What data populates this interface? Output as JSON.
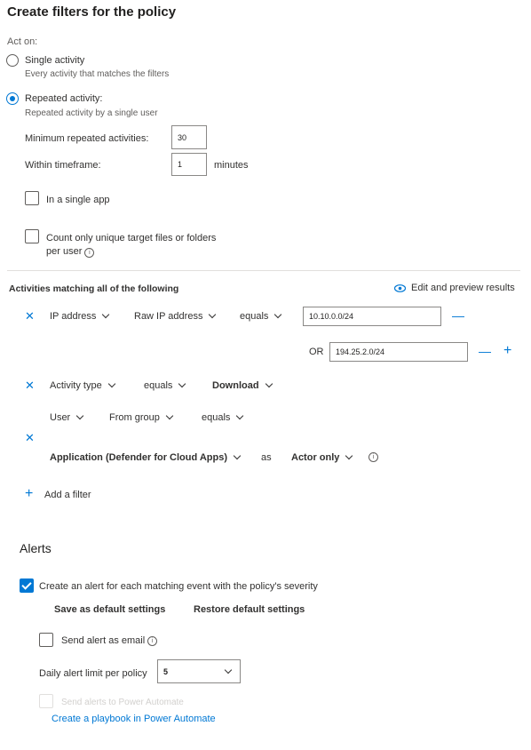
{
  "page_title": "Create filters for the policy",
  "act_on": {
    "label": "Act on:",
    "single": {
      "label": "Single activity",
      "description": "Every activity that matches the filters",
      "selected": false
    },
    "repeated": {
      "label": "Repeated activity:",
      "description": "Repeated activity by a single user",
      "selected": true
    },
    "min_label": "Minimum repeated activities:",
    "min_value": "30",
    "timeframe_label": "Within timeframe:",
    "timeframe_value": "1",
    "timeframe_unit": "minutes",
    "single_app": "In a single app",
    "unique_line1": "Count only unique target files or folders",
    "unique_line2": "per user"
  },
  "activities": {
    "header": "Activities matching all of the following",
    "edit_preview": "Edit and preview results",
    "filter1": {
      "field": "IP address",
      "subfield": "Raw IP address",
      "operator": "equals",
      "value": "10.10.0.0/24",
      "or_label": "OR",
      "value2": "194.25.2.0/24"
    },
    "filter2": {
      "field": "Activity type",
      "operator": "equals",
      "value": "Download"
    },
    "filter3": {
      "field": "User",
      "subfield": "From group",
      "operator": "equals",
      "app_field": "Application (Defender for Cloud Apps)",
      "as_label": "as",
      "actor": "Actor only"
    },
    "add_filter": "Add a filter"
  },
  "alerts": {
    "title": "Alerts",
    "create_alert": "Create an alert for each matching event with the policy's severity",
    "save_default": "Save as default settings",
    "restore_default": "Restore default settings",
    "send_email": "Send alert as email",
    "daily_limit_label": "Daily alert limit per policy",
    "daily_limit_value": "5",
    "send_power_automate": "Send alerts to Power Automate",
    "create_playbook": "Create a playbook in Power Automate"
  },
  "colors": {
    "accent": "#0078d4",
    "text": "#323130",
    "muted": "#605e5c",
    "border": "#8a8886"
  }
}
